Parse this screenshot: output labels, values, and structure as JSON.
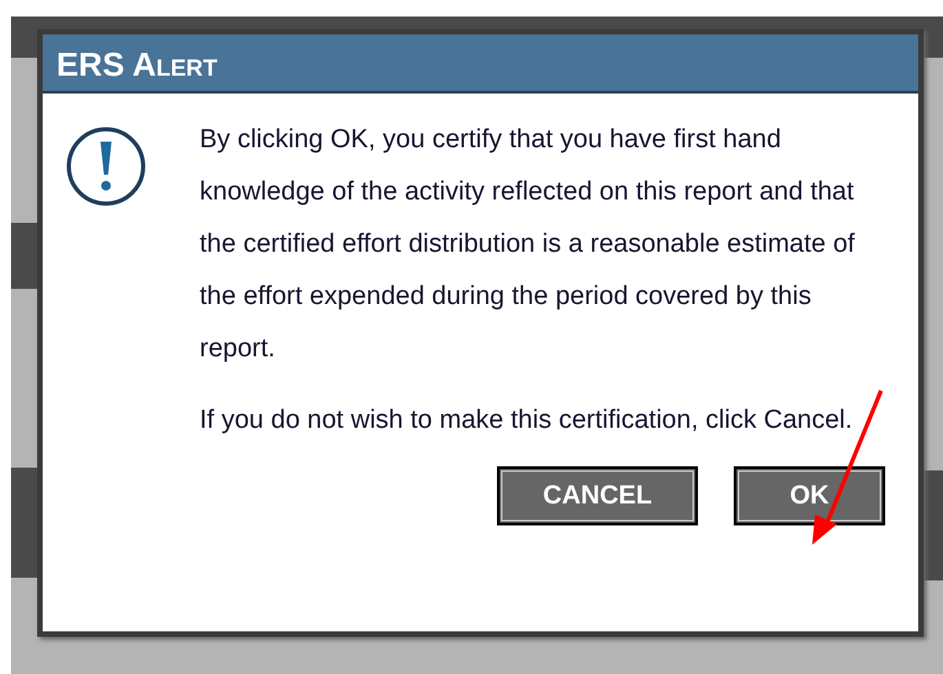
{
  "dialog": {
    "title": "ERS Alert",
    "paragraphs": [
      "By clicking OK, you certify that you have first hand knowledge of the activity reflected on this report and that the certified effort distribution is a reasonable estimate of the effort expended during the period covered by this report.",
      "If you do not wish to make this certification, click Cancel."
    ],
    "buttons": [
      {
        "label": "CANCEL",
        "kind": "cancel"
      },
      {
        "label": "OK",
        "kind": "ok"
      }
    ]
  }
}
